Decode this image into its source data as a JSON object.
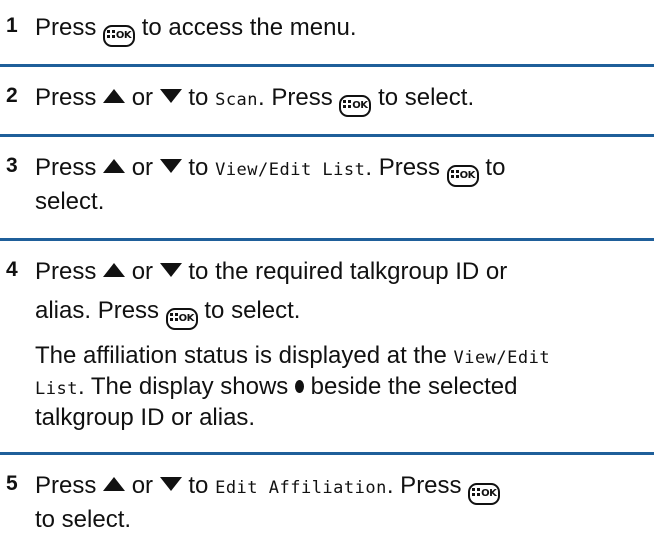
{
  "step1": {
    "number": "1",
    "press": "Press",
    "rest": "to access the menu."
  },
  "step2": {
    "number": "2",
    "press": "Press",
    "or": "or",
    "to": "to",
    "menu": "Scan",
    "sep": ". Press",
    "select": "to select."
  },
  "step3": {
    "number": "3",
    "press": "Press",
    "or": "or",
    "to": "to",
    "menu": "View/Edit List",
    "sep": ". Press",
    "to2": "to",
    "select": "select."
  },
  "step4": {
    "number": "4",
    "press": "Press",
    "or": "or",
    "rest": "to the required talkgroup ID or",
    "line2a": "alias. Press",
    "line2b": "to select.",
    "note1a": "The affiliation status is displayed at the",
    "note1b": "View/Edit",
    "note2a": "List",
    "note2b": ". The display shows",
    "note2c": "beside the selected",
    "note3": "talkgroup ID or alias."
  },
  "step5": {
    "number": "5",
    "press": "Press",
    "or": "or",
    "to": "to",
    "menu": "Edit Affiliation",
    "sep": ". Press",
    "select": "to select."
  },
  "ok_key": {
    "label": "OK",
    "icon": "menu-ok-key"
  },
  "colors": {
    "rule": "#1f5f9a",
    "text": "#111111"
  }
}
